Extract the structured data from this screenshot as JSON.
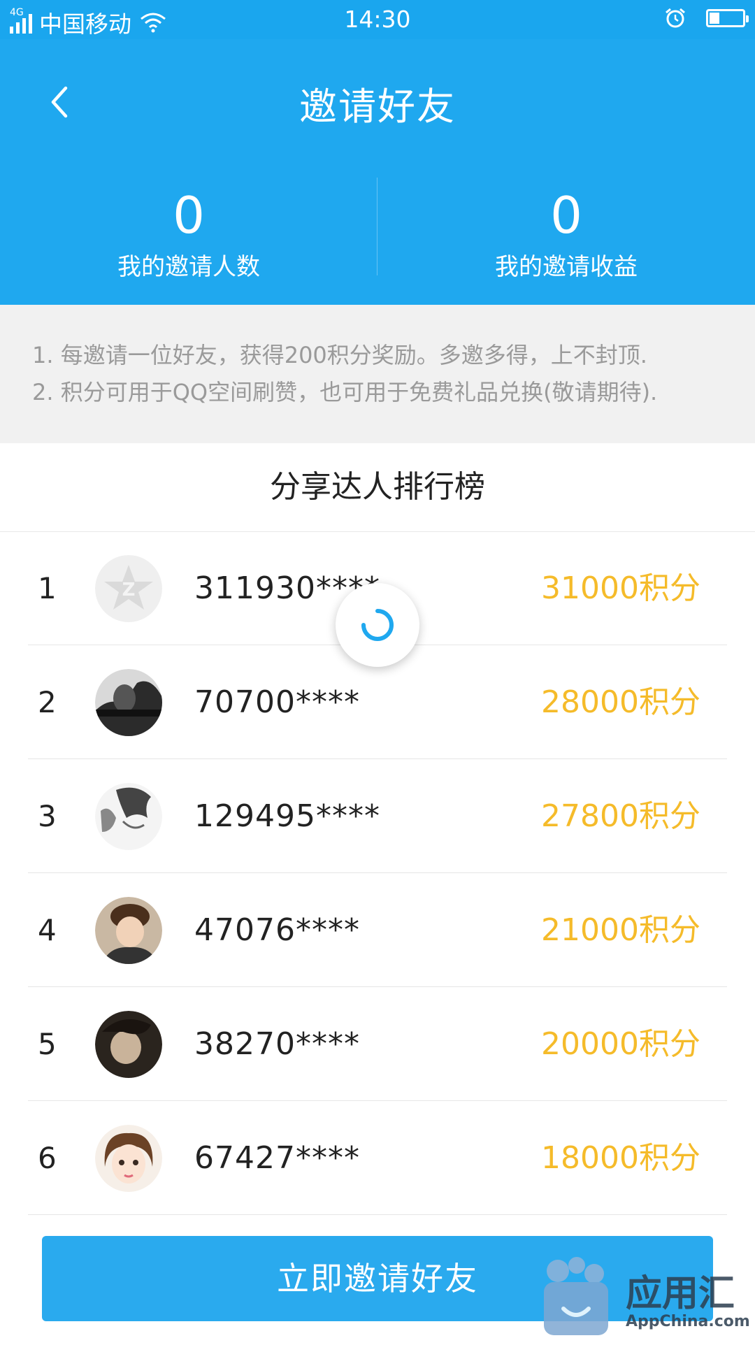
{
  "status_bar": {
    "network": "4G",
    "carrier": "中国移动",
    "time": "14:30",
    "battery_level": 0.3,
    "icons": [
      "signal-icon",
      "wifi-icon",
      "alarm-icon",
      "battery-icon"
    ]
  },
  "header": {
    "title": "邀请好友",
    "back_icon": "chevron-left-icon",
    "stats": [
      {
        "value": "0",
        "label": "我的邀请人数"
      },
      {
        "value": "0",
        "label": "我的邀请收益"
      }
    ]
  },
  "rules": [
    "1. 每邀请一位好友，获得200积分奖励。多邀多得，上不封顶.",
    "2. 积分可用于QQ空间刷赞，也可用于免费礼品兑换(敬请期待)."
  ],
  "ranking": {
    "title": "分享达人排行榜",
    "rows": [
      {
        "rank": "1",
        "user": "311930****",
        "points": "31000积分",
        "avatar": "default-qzone"
      },
      {
        "rank": "2",
        "user": "70700****",
        "points": "28000积分",
        "avatar": "photo"
      },
      {
        "rank": "3",
        "user": "129495****",
        "points": "27800积分",
        "avatar": "sketch"
      },
      {
        "rank": "4",
        "user": "47076****",
        "points": "21000积分",
        "avatar": "photo"
      },
      {
        "rank": "5",
        "user": "38270****",
        "points": "20000积分",
        "avatar": "photo"
      },
      {
        "rank": "6",
        "user": "67427****",
        "points": "18000积分",
        "avatar": "cartoon"
      }
    ]
  },
  "invite_button": "立即邀请好友",
  "watermark": {
    "name": "应用汇",
    "site": "AppChina.com"
  },
  "colors": {
    "primary": "#1fa8ef",
    "points": "#f5bb2a",
    "rules_bg": "#f1f1f1"
  }
}
